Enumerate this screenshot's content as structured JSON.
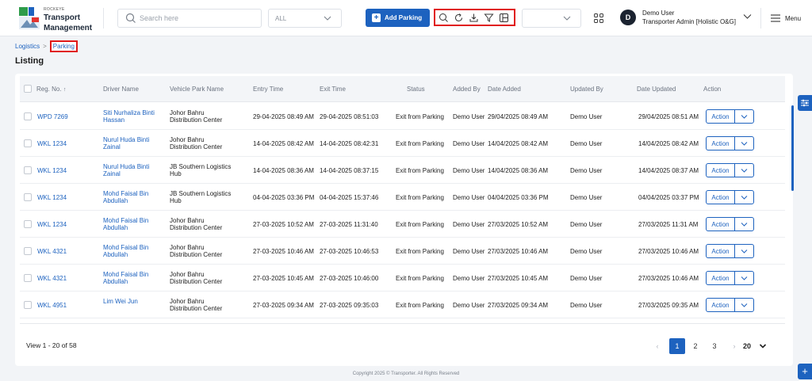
{
  "header": {
    "brand_small": "ROCKEYE",
    "brand_line1": "Transport",
    "brand_line2": "Management",
    "search_placeholder": "Search here",
    "filter_value": "ALL",
    "add_button_label": "Add Parking",
    "tools": [
      "search-icon",
      "refresh-icon",
      "download-icon",
      "filter-icon",
      "columns-icon"
    ],
    "user_initial": "D",
    "user_name": "Demo User",
    "user_role": "Transporter Admin [Holistic O&G]",
    "menu_label": "Menu"
  },
  "breadcrumb": {
    "parent": "Logistics",
    "separator": ">",
    "current": "Parking"
  },
  "page_title": "Listing",
  "table": {
    "columns": {
      "reg_no": "Reg. No.",
      "driver": "Driver Name",
      "park": "Vehicle Park Name",
      "entry": "Entry Time",
      "exit": "Exit Time",
      "status": "Status",
      "added_by": "Added By",
      "date_added": "Date Added",
      "updated_by": "Updated By",
      "date_updated": "Date Updated",
      "action": "Action"
    },
    "action_label": "Action",
    "rows": [
      {
        "reg": "WPD 7269",
        "driver": "Siti Nurhaliza Binti Hassan",
        "park": "Johor Bahru Distribution Center",
        "entry": "29-04-2025 08:49 AM",
        "exit": "29-04-2025 08:51:03",
        "status": "Exit from Parking",
        "added_by": "Demo User",
        "date_added": "29/04/2025 08:49 AM",
        "updated_by": "Demo User",
        "date_updated": "29/04/2025 08:51 AM"
      },
      {
        "reg": "WKL 1234",
        "driver": "Nurul Huda Binti Zainal",
        "park": "Johor Bahru Distribution Center",
        "entry": "14-04-2025 08:42 AM",
        "exit": "14-04-2025 08:42:31",
        "status": "Exit from Parking",
        "added_by": "Demo User",
        "date_added": "14/04/2025 08:42 AM",
        "updated_by": "Demo User",
        "date_updated": "14/04/2025 08:42 AM"
      },
      {
        "reg": "WKL 1234",
        "driver": "Nurul Huda Binti Zainal",
        "park": "JB Southern Logistics Hub",
        "entry": "14-04-2025 08:36 AM",
        "exit": "14-04-2025 08:37:15",
        "status": "Exit from Parking",
        "added_by": "Demo User",
        "date_added": "14/04/2025 08:36 AM",
        "updated_by": "Demo User",
        "date_updated": "14/04/2025 08:37 AM"
      },
      {
        "reg": "WKL 1234",
        "driver": "Mohd Faisal Bin Abdullah",
        "park": "JB Southern Logistics Hub",
        "entry": "04-04-2025 03:36 PM",
        "exit": "04-04-2025 15:37:46",
        "status": "Exit from Parking",
        "added_by": "Demo User",
        "date_added": "04/04/2025 03:36 PM",
        "updated_by": "Demo User",
        "date_updated": "04/04/2025 03:37 PM"
      },
      {
        "reg": "WKL 1234",
        "driver": "Mohd Faisal Bin Abdullah",
        "park": "Johor Bahru Distribution Center",
        "entry": "27-03-2025 10:52 AM",
        "exit": "27-03-2025 11:31:40",
        "status": "Exit from Parking",
        "added_by": "Demo User",
        "date_added": "27/03/2025 10:52 AM",
        "updated_by": "Demo User",
        "date_updated": "27/03/2025 11:31 AM"
      },
      {
        "reg": "WKL 4321",
        "driver": "Mohd Faisal Bin Abdullah",
        "park": "Johor Bahru Distribution Center",
        "entry": "27-03-2025 10:46 AM",
        "exit": "27-03-2025 10:46:53",
        "status": "Exit from Parking",
        "added_by": "Demo User",
        "date_added": "27/03/2025 10:46 AM",
        "updated_by": "Demo User",
        "date_updated": "27/03/2025 10:46 AM"
      },
      {
        "reg": "WKL 4321",
        "driver": "Mohd Faisal Bin Abdullah",
        "park": "Johor Bahru Distribution Center",
        "entry": "27-03-2025 10:45 AM",
        "exit": "27-03-2025 10:46:00",
        "status": "Exit from Parking",
        "added_by": "Demo User",
        "date_added": "27/03/2025 10:45 AM",
        "updated_by": "Demo User",
        "date_updated": "27/03/2025 10:46 AM"
      },
      {
        "reg": "WKL 4951",
        "driver": "Lim Wei Jun",
        "park": "Johor Bahru Distribution Center",
        "entry": "27-03-2025 09:34 AM",
        "exit": "27-03-2025 09:35:03",
        "status": "Exit from Parking",
        "added_by": "Demo User",
        "date_added": "27/03/2025 09:34 AM",
        "updated_by": "Demo User",
        "date_updated": "27/03/2025 09:35 AM"
      }
    ]
  },
  "pagination": {
    "view_text": "View 1 - 20 of 58",
    "pages": [
      "1",
      "2",
      "3"
    ],
    "current_page": "1",
    "page_size": "20"
  },
  "footer": "Copyright 2025 © Transporter. All Rights Reserved",
  "colors": {
    "primary": "#1d62bf",
    "highlight": "#e01818"
  }
}
